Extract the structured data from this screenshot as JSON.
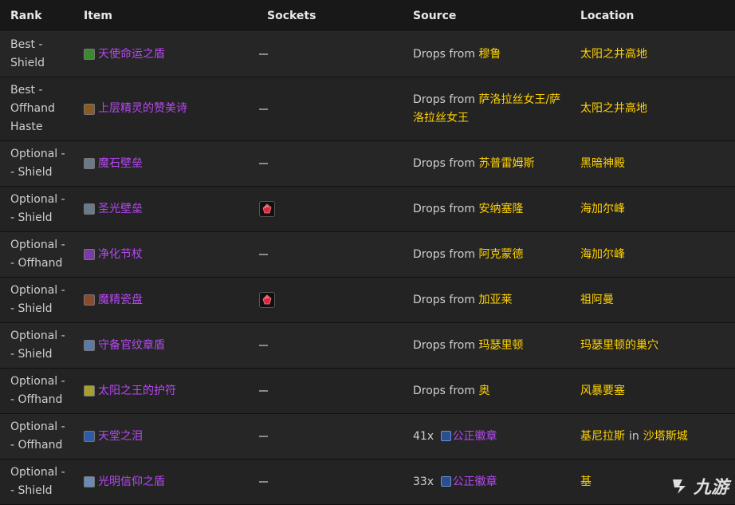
{
  "headers": {
    "rank": "Rank",
    "item": "Item",
    "sockets": "Sockets",
    "source": "Source",
    "location": "Location"
  },
  "rows": [
    {
      "rank": [
        "Best -",
        "Shield"
      ],
      "item": "天使命运之盾",
      "icon_color": "#3a8a2e",
      "socket": "-",
      "source_prefix": "Drops from ",
      "source_name": "穆鲁",
      "source_name_line2": "",
      "location": "太阳之井高地",
      "location_in": "",
      "location2": ""
    },
    {
      "rank": [
        "Best -",
        "Offhand",
        "Haste"
      ],
      "item": "上层精灵的赞美诗",
      "icon_color": "#8a5a1e",
      "socket": "-",
      "source_prefix": "Drops from ",
      "source_name": "萨洛拉丝女王/萨",
      "source_name_line2": "洛拉丝女王",
      "location": "太阳之井高地",
      "location_in": "",
      "location2": ""
    },
    {
      "rank": [
        "Optional -",
        "- Shield"
      ],
      "item": "魔石壁垒",
      "icon_color": "#6a7a8a",
      "socket": "-",
      "source_prefix": "Drops from ",
      "source_name": "苏普雷姆斯",
      "source_name_line2": "",
      "location": "黑暗神殿",
      "location_in": "",
      "location2": ""
    },
    {
      "rank": [
        "Optional -",
        "- Shield"
      ],
      "item": "圣光壁垒",
      "icon_color": "#6a7a8a",
      "socket": "gem",
      "source_prefix": "Drops from ",
      "source_name": "安纳塞隆",
      "source_name_line2": "",
      "location": "海加尔峰",
      "location_in": "",
      "location2": ""
    },
    {
      "rank": [
        "Optional -",
        "- Offhand"
      ],
      "item": "净化节杖",
      "icon_color": "#7a3aa8",
      "socket": "-",
      "source_prefix": "Drops from ",
      "source_name": "阿克蒙德",
      "source_name_line2": "",
      "location": "海加尔峰",
      "location_in": "",
      "location2": ""
    },
    {
      "rank": [
        "Optional -",
        "- Shield"
      ],
      "item": "魔精瓷盘",
      "icon_color": "#8a4a2e",
      "socket": "gem",
      "source_prefix": "Drops from ",
      "source_name": "加亚莱",
      "source_name_line2": "",
      "location": "祖阿曼",
      "location_in": "",
      "location2": ""
    },
    {
      "rank": [
        "Optional -",
        "- Shield"
      ],
      "item": "守备官纹章盾",
      "icon_color": "#5a7aa8",
      "socket": "-",
      "source_prefix": "Drops from ",
      "source_name": "玛瑟里顿",
      "source_name_line2": "",
      "location": "玛瑟里顿的巢穴",
      "location_in": "",
      "location2": ""
    },
    {
      "rank": [
        "Optional -",
        "- Offhand"
      ],
      "item": "太阳之王的护符",
      "icon_color": "#a8a02e",
      "socket": "-",
      "source_prefix": "Drops from ",
      "source_name": "奥",
      "source_name_line2": "",
      "location": "风暴要塞",
      "location_in": "",
      "location2": ""
    },
    {
      "rank": [
        "Optional -",
        "- Offhand"
      ],
      "item": "天堂之泪",
      "icon_color": "#2e5aa8",
      "socket": "-",
      "source_prefix": "41x ",
      "source_name": "公正徽章",
      "source_name_line2": "",
      "location": "基尼拉斯",
      "location_in": "in",
      "location2": "沙塔斯城"
    },
    {
      "rank": [
        "Optional -",
        "- Shield"
      ],
      "item": "光明信仰之盾",
      "icon_color": "#6a8ab8",
      "socket": "-",
      "source_prefix": "33x ",
      "source_name": "公正徽章",
      "source_name_line2": "",
      "location": "基",
      "location_in": "",
      "location2": ""
    }
  ],
  "watermark": "九游"
}
